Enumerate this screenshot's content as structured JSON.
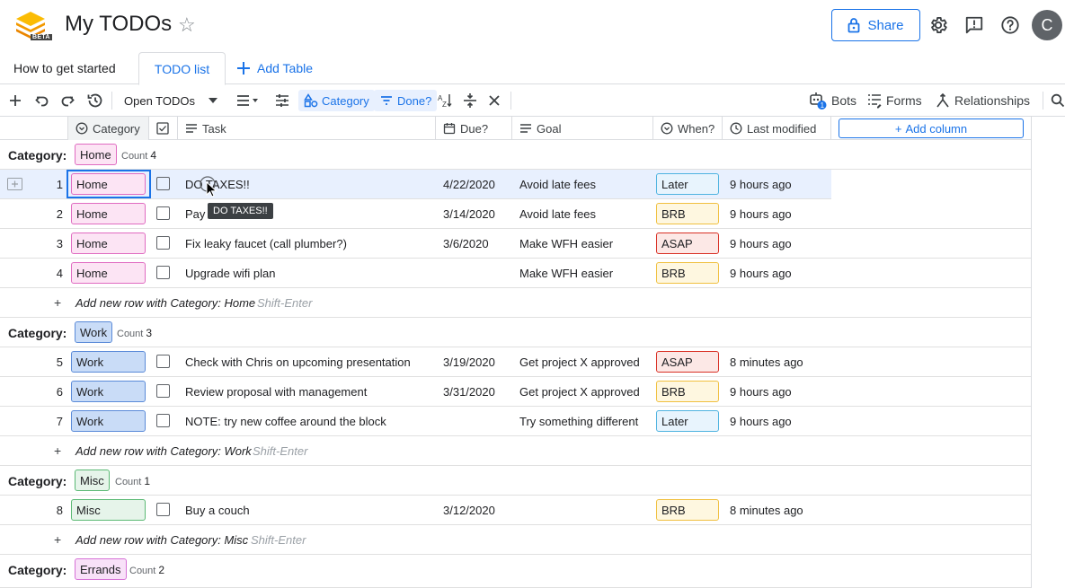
{
  "header": {
    "title": "My TODOs",
    "beta": "BETA",
    "share_label": "Share",
    "avatar_initial": "C"
  },
  "tabs": {
    "items": [
      "How to get started",
      "TODO list"
    ],
    "active": "TODO list",
    "add_table_label": "Add Table"
  },
  "toolbar": {
    "view_name": "Open TODOs",
    "group_chip": "Category",
    "filter_chip": "Done?",
    "bots_label": "Bots",
    "bots_badge": "1",
    "forms_label": "Forms",
    "relationships_label": "Relationships"
  },
  "columns": {
    "category": "Category",
    "task": "Task",
    "due": "Due?",
    "goal": "Goal",
    "when": "When?",
    "modified": "Last modified",
    "add_column": "Add column"
  },
  "groups": [
    {
      "label": "Category:",
      "value": "Home",
      "count_label": "Count",
      "count": "4",
      "add_row_text": "Add new row with Category: Home",
      "add_row_key": "Shift-Enter",
      "rows": [
        {
          "num": "1",
          "category": "Home",
          "task": "DO TAXES!!",
          "due": "4/22/2020",
          "goal": "Avoid late fees",
          "when": "Later",
          "modified": "9 hours ago"
        },
        {
          "num": "2",
          "category": "Home",
          "task": "Pay",
          "due": "3/14/2020",
          "goal": "Avoid late fees",
          "when": "BRB",
          "modified": "9 hours ago"
        },
        {
          "num": "3",
          "category": "Home",
          "task": "Fix leaky faucet (call plumber?)",
          "due": "3/6/2020",
          "goal": "Make WFH easier",
          "when": "ASAP",
          "modified": "9 hours ago"
        },
        {
          "num": "4",
          "category": "Home",
          "task": "Upgrade wifi plan",
          "due": "",
          "goal": "Make WFH easier",
          "when": "BRB",
          "modified": "9 hours ago"
        }
      ]
    },
    {
      "label": "Category:",
      "value": "Work",
      "count_label": "Count",
      "count": "3",
      "add_row_text": "Add new row with Category: Work",
      "add_row_key": "Shift-Enter",
      "rows": [
        {
          "num": "5",
          "category": "Work",
          "task": "Check with Chris on upcoming presentation",
          "due": "3/19/2020",
          "goal": "Get project X approved",
          "when": "ASAP",
          "modified": "8 minutes ago"
        },
        {
          "num": "6",
          "category": "Work",
          "task": "Review proposal with management",
          "due": "3/31/2020",
          "goal": "Get project X approved",
          "when": "BRB",
          "modified": "9 hours ago"
        },
        {
          "num": "7",
          "category": "Work",
          "task": "NOTE: try new coffee around the block",
          "due": "",
          "goal": "Try something different",
          "when": "Later",
          "modified": "9 hours ago"
        }
      ]
    },
    {
      "label": "Category:",
      "value": "Misc",
      "count_label": "Count",
      "count": "1",
      "add_row_text": "Add new row with Category: Misc",
      "add_row_key": "Shift-Enter",
      "rows": [
        {
          "num": "8",
          "category": "Misc",
          "task": "Buy a couch",
          "due": "3/12/2020",
          "goal": "",
          "when": "BRB",
          "modified": "8 minutes ago"
        }
      ]
    },
    {
      "label": "Category:",
      "value": "Errands",
      "count_label": "Count",
      "count": "2",
      "rows": []
    }
  ],
  "tooltip": "DO TAXES!!",
  "colors": {
    "accent": "#1a73e8"
  }
}
